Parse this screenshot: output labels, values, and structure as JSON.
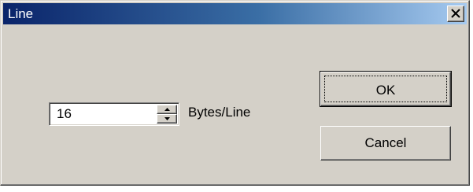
{
  "window": {
    "title": "Line",
    "close_icon": "close-icon"
  },
  "spinner": {
    "value": "16",
    "unit_label": "Bytes/Line"
  },
  "buttons": {
    "ok_label": "OK",
    "cancel_label": "Cancel"
  },
  "colors": {
    "titlebar_start": "#0a246a",
    "titlebar_end": "#a6caf0",
    "dialog_face": "#d4d0c8"
  }
}
